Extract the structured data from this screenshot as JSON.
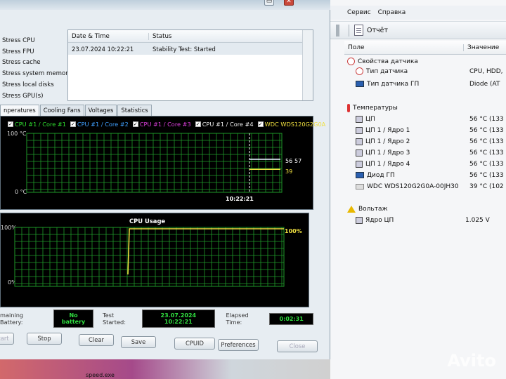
{
  "left": {
    "stress_items": [
      "Stress CPU",
      "Stress FPU",
      "Stress cache",
      "Stress system memory",
      "Stress local disks",
      "Stress GPU(s)"
    ],
    "log": {
      "columns": [
        "Date & Time",
        "Status"
      ],
      "rows": [
        {
          "datetime": "23.07.2024 10:22:21",
          "status": "Stability Test: Started"
        }
      ]
    },
    "tabs": [
      "nperatures",
      "Cooling Fans",
      "Voltages",
      "Statistics"
    ],
    "temp_graph": {
      "legend": [
        {
          "label": "CPU #1 / Core #1",
          "color": "#30e030"
        },
        {
          "label": "CPU #1 / Core #2",
          "color": "#40a0ff"
        },
        {
          "label": "CPU #1 / Core #3",
          "color": "#e040e0"
        },
        {
          "label": "CPU #1 / Core #4",
          "color": "#f0f0f0"
        },
        {
          "label": "WDC WDS120G2G0A",
          "color": "#f0e040"
        }
      ],
      "y_top": "100 °C",
      "y_bottom": "0 °C",
      "time": "10:22:21",
      "val_a": "56",
      "val_b": "57",
      "val_c": "39",
      "chart_data": {
        "type": "line",
        "ylim": [
          0,
          100
        ],
        "series": [
          {
            "name": "CPU #1 / Core #1",
            "values": [
              56,
              56,
              56,
              56
            ]
          },
          {
            "name": "WDC WDS120G2G0A",
            "values": [
              39,
              39,
              39,
              39
            ]
          }
        ]
      }
    },
    "usage_graph": {
      "title": "CPU Usage",
      "y_top": "100%",
      "y_bottom": "0%",
      "value": "100%",
      "chart_data": {
        "type": "line",
        "ylim": [
          0,
          100
        ],
        "series": [
          {
            "name": "CPU Usage",
            "values": [
              0,
              100,
              100,
              100,
              100
            ]
          }
        ]
      }
    },
    "status": {
      "battery_label": "maining Battery:",
      "battery_value": "No battery",
      "started_label": "Test Started:",
      "started_value": "23.07.2024 10:22:21",
      "elapsed_label": "Elapsed Time:",
      "elapsed_value": "0:02:31"
    },
    "buttons": {
      "start": "tart",
      "stop": "Stop",
      "clear": "Clear",
      "save": "Save",
      "cpuid": "CPUID",
      "preferences": "Preferences",
      "close": "Close"
    }
  },
  "right": {
    "menu": [
      "Сервис",
      "Справка"
    ],
    "toolbar_report": "Отчёт",
    "columns": [
      "Поле",
      "Значение"
    ],
    "rows": [
      {
        "name": "Свойства датчика",
        "value": "",
        "icon": "gauge-icon",
        "group": true
      },
      {
        "name": "Тип датчика",
        "value": "CPU, HDD,",
        "icon": "gauge-icon"
      },
      {
        "name": "Тип датчика ГП",
        "value": "Diode  (AT",
        "icon": "monitor-icon"
      },
      {
        "name": "Температуры",
        "value": "",
        "icon": "thermometer-icon",
        "group": true
      },
      {
        "name": "ЦП",
        "value": "56 °C  (133",
        "icon": "chip-icon"
      },
      {
        "name": "ЦП 1 / Ядро 1",
        "value": "56 °C  (133",
        "icon": "chip-icon"
      },
      {
        "name": "ЦП 1 / Ядро 2",
        "value": "56 °C  (133",
        "icon": "chip-icon"
      },
      {
        "name": "ЦП 1 / Ядро 3",
        "value": "56 °C  (133",
        "icon": "chip-icon"
      },
      {
        "name": "ЦП 1 / Ядро 4",
        "value": "56 °C  (133",
        "icon": "chip-icon"
      },
      {
        "name": "Диод ГП",
        "value": "56 °C  (133",
        "icon": "monitor-icon"
      },
      {
        "name": "WDC WDS120G2G0A-00JH30",
        "value": "39 °C  (102 °",
        "icon": "drive-icon"
      },
      {
        "name": "Вольтаж",
        "value": "",
        "icon": "warning-icon",
        "group": true
      },
      {
        "name": "Ядро ЦП",
        "value": "1.025 V",
        "icon": "chip-icon"
      }
    ]
  },
  "taskbar": {
    "item_label": "speed.exe"
  },
  "watermark": "Avito"
}
